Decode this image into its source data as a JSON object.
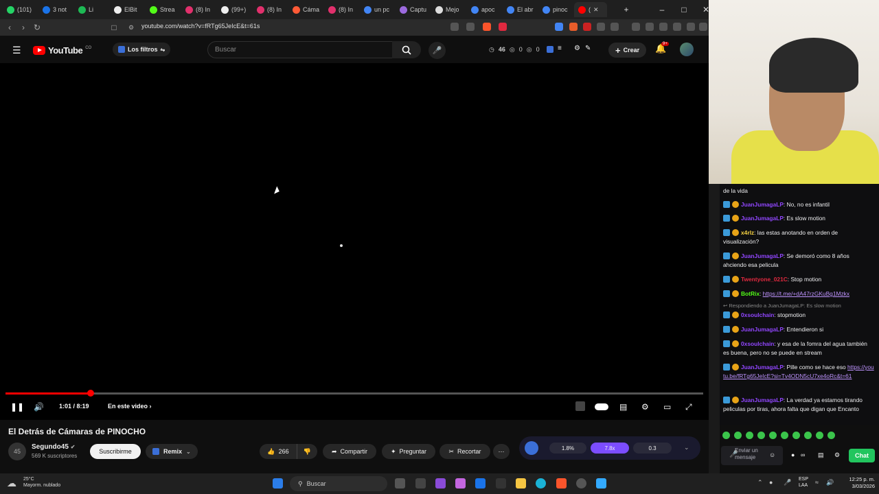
{
  "tabs": [
    {
      "label": "(101)",
      "color": "#25d366"
    },
    {
      "label": "3 not",
      "color": "#1a73e8"
    },
    {
      "label": "Li",
      "color": "#1db954"
    },
    {
      "label": "ElBit",
      "color": "#eeeeee"
    },
    {
      "label": "Strea",
      "color": "#53fc18"
    },
    {
      "label": "(8) In",
      "color": "#e1306c"
    },
    {
      "label": "(99+)",
      "color": "#eeeeee"
    },
    {
      "label": "(8) In",
      "color": "#e1306c"
    },
    {
      "label": "Cáma",
      "color": "#ff5a36"
    },
    {
      "label": "(8) In",
      "color": "#e1306c"
    },
    {
      "label": "un pc",
      "color": "#4285f4"
    },
    {
      "label": "Captu",
      "color": "#9c6ade"
    },
    {
      "label": "Mejo",
      "color": "#dddddd"
    },
    {
      "label": "apoc",
      "color": "#4285f4"
    },
    {
      "label": "El abr",
      "color": "#4285f4"
    },
    {
      "label": "pinoc",
      "color": "#4285f4"
    },
    {
      "label": "(",
      "color": "#ff0000"
    }
  ],
  "address": {
    "url": "youtube.com/watch?v=fRTg65JeIcE&t=61s"
  },
  "yt": {
    "logo": "YouTube",
    "country": "CO",
    "filters": "Los filtros",
    "search_placeholder": "Buscar",
    "stats": [
      "46",
      "0",
      "0"
    ],
    "create": "Crear",
    "notif_badge": "9+"
  },
  "player": {
    "time": "1:01 / 8:19",
    "chapter": "En este video",
    "progress_fraction": 0.122
  },
  "video": {
    "title": "El Detrás de Cámaras de PINOCHO",
    "channel": "Segundo45",
    "channel_initials": "45",
    "subscribers": "569 K suscriptores",
    "subscribe": "Suscribirme",
    "remix": "Remix",
    "likes": "266",
    "share": "Compartir",
    "ask": "Preguntar",
    "clip": "Recortar"
  },
  "iq": {
    "v1": "1.8%",
    "v2": "7.8x",
    "v3": "0.3",
    "accent": "#7c4dff"
  },
  "chat": {
    "top_fragment": "de la vida",
    "messages": [
      {
        "user": "JuanJumagaLP",
        "color": "#9146ff",
        "text": ": No, no es infantil"
      },
      {
        "user": "JuanJumagaLP",
        "color": "#9146ff",
        "text": ": Es slow motion"
      },
      {
        "user": "x4rlz",
        "color": "#f5d142",
        "text": ": las estas anotando en orden de visualización?"
      },
      {
        "user": "JuanJumagaLP",
        "color": "#9146ff",
        "text": ": Se demoró como 8 años ahciendo esa pelicula"
      },
      {
        "user": "Twentyone_021C",
        "color": "#e0293f",
        "text": ": Stop motion"
      },
      {
        "user": "BotRix",
        "color": "#53fc18",
        "text": ": ",
        "link": "https://t.me/+dA47rzGKuBg1Mzkx"
      },
      {
        "user": "0xsoulchain",
        "color": "#9146ff",
        "text": ": stopmotion"
      },
      {
        "user": "JuanJumagaLP",
        "color": "#9146ff",
        "text": ": Entendieron si"
      },
      {
        "user": "0xsoulchain",
        "color": "#9146ff",
        "text": ": y esa de la fomra del agua también es buena, pero no se puede en stream"
      },
      {
        "user": "JuanJumagaLP",
        "color": "#9146ff",
        "text": ": Pille como se hace eso ",
        "link": "https://youtu.be/fRTg65JeIcE?si=Tv4ODN5cU7xe4oRc&t=61"
      },
      {
        "user": "JuanJumagaLP",
        "color": "#9146ff",
        "text": ": La verdad ya estamos tirando peliculas por tiras, ahora falta que digan que Encanto"
      }
    ],
    "reply_note": "Respondiendo a JuanJumagaLP: Es slow motion",
    "input_placeholder": "Enviar un mensaje",
    "send": "Chat"
  },
  "taskbar": {
    "temp": "25°C",
    "weather": "Mayorm. nublado",
    "search": "Buscar",
    "lang1": "ESP",
    "lang2": "LAA",
    "time": "12:25 p. m.",
    "date": "3/03/2026"
  }
}
